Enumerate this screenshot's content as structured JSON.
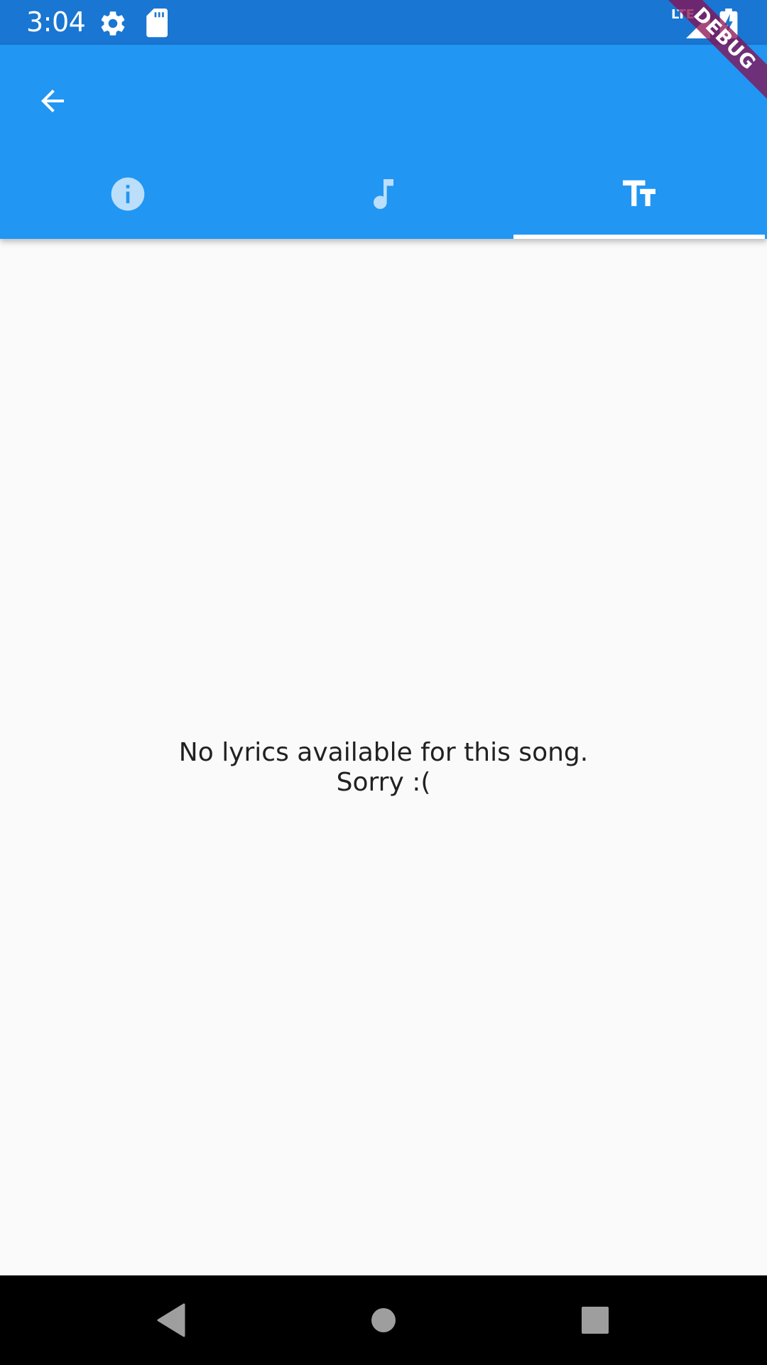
{
  "status_bar": {
    "time": "3:04",
    "network": "LTE",
    "icons": [
      "gear-icon",
      "sd-card-icon",
      "signal-icon",
      "battery-charging-icon"
    ]
  },
  "debug_banner": "DEBUG",
  "app_bar": {
    "back_icon": "arrow-back-icon",
    "tabs": [
      {
        "icon": "info-icon",
        "selected": false
      },
      {
        "icon": "music-note-icon",
        "selected": false
      },
      {
        "icon": "text-fields-icon",
        "selected": true
      }
    ]
  },
  "content": {
    "message_line1": "No lyrics available for this song.",
    "message_line2": "Sorry :("
  },
  "nav_bar": {
    "buttons": [
      "nav-back-icon",
      "nav-home-icon",
      "nav-recents-icon"
    ]
  },
  "colors": {
    "status_bar": "#1976d2",
    "app_bar": "#2196f3",
    "background": "#fafafa",
    "text": "#212121",
    "unselected_tab_icon": "#bbdefb",
    "debug_banner": "#880e4f"
  }
}
